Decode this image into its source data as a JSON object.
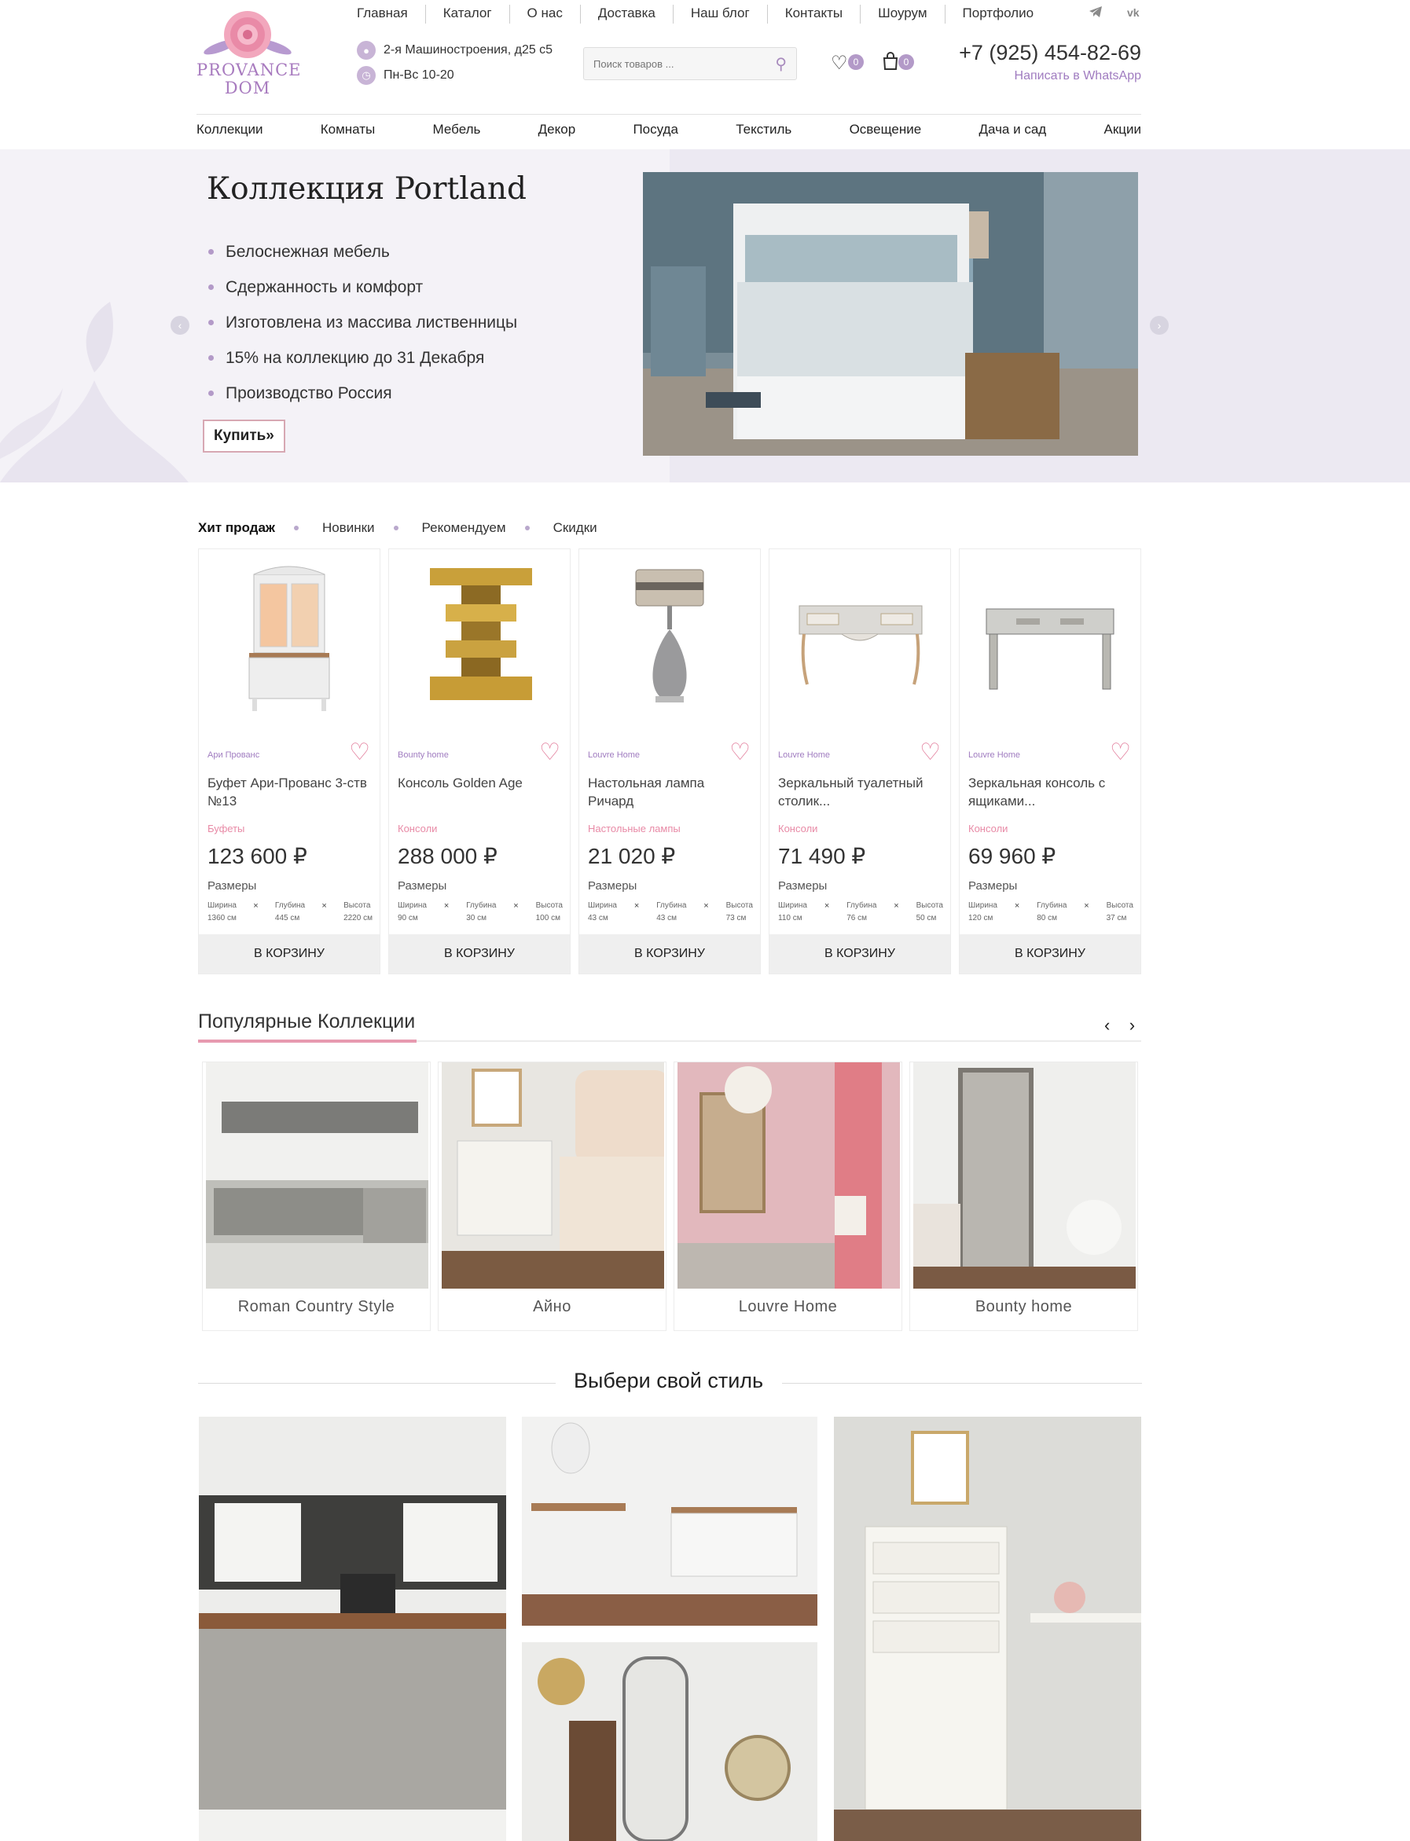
{
  "header": {
    "logo_line1": "PROVANCE",
    "logo_line2": "DOM",
    "topnav": [
      "Главная",
      "Каталог",
      "О нас",
      "Доставка",
      "Наш блог",
      "Контакты",
      "Шоурум",
      "Портфолио"
    ],
    "address": "2-я Машиностроения, д25 с5",
    "hours": "Пн-Вс 10-20",
    "search_placeholder": "Поиск товаров ...",
    "wishlist_count": "0",
    "cart_count": "0",
    "phone": "+7 (925) 454-82-69",
    "whatsapp": "Написать в WhatsApp",
    "social": [
      "telegram-icon",
      "vk-icon"
    ]
  },
  "mainnav": [
    "Коллекции",
    "Комнаты",
    "Мебель",
    "Декор",
    "Посуда",
    "Текстиль",
    "Освещение",
    "Дача и сад",
    "Акции"
  ],
  "hero": {
    "title": "Коллекция Portland",
    "bullets": [
      "Белоснежная мебель",
      "Сдержанность и комфорт",
      "Изготовлена из массива лиственницы",
      "15% на коллекцию до 31 Декабря",
      "Производство Россия"
    ],
    "button": "Купить»"
  },
  "tabs": [
    "Хит продаж",
    "Новинки",
    "Рекомендуем",
    "Скидки"
  ],
  "products": [
    {
      "brand": "Ари Прованс",
      "name": "Буфет Ари-Прованс 3-ств №13",
      "category": "Буфеты",
      "price": "123 600",
      "w": "1360 см",
      "d": "445 см",
      "h": "2220 см"
    },
    {
      "brand": "Bounty home",
      "name": "Консоль Golden Age",
      "category": "Консоли",
      "price": "288 000",
      "w": "90 см",
      "d": "30 см",
      "h": "100 см"
    },
    {
      "brand": "Louvre Home",
      "name": "Настольная лампа Ричард",
      "category": "Настольные лампы",
      "price": "21 020",
      "w": "43 см",
      "d": "43 см",
      "h": "73 см"
    },
    {
      "brand": "Louvre Home",
      "name": "Зеркальный туалетный столик...",
      "category": "Консоли",
      "price": "71 490",
      "w": "110 см",
      "d": "76 см",
      "h": "50 см"
    },
    {
      "brand": "Louvre Home",
      "name": "Зеркальная консоль с ящиками...",
      "category": "Консоли",
      "price": "69 960",
      "w": "120 см",
      "d": "80 см",
      "h": "37 см"
    }
  ],
  "product_labels": {
    "currency": "₽",
    "dims_title": "Размеры",
    "width": "Ширина",
    "depth": "Глубина",
    "height": "Высота",
    "times": "×",
    "cart_button": "В КОРЗИНУ"
  },
  "collections": {
    "title": "Популярные Коллекции",
    "items": [
      "Roman Country Style",
      "Айно",
      "Louvre Home",
      "Bounty home"
    ]
  },
  "style_section": {
    "title": "Выбери свой стиль"
  },
  "colors": {
    "accent_purple": "#a07cc0",
    "accent_pink": "#e79ab0",
    "hero_bg": "#ece9f2"
  }
}
